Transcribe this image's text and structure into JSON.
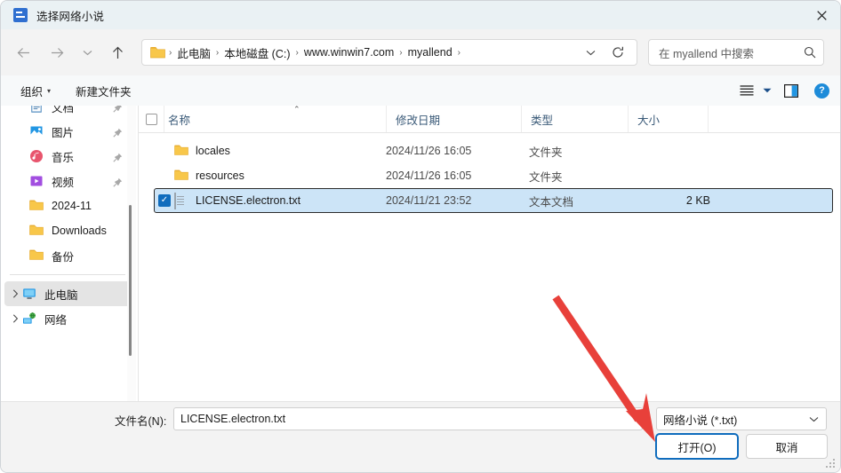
{
  "window": {
    "title": "选择网络小说",
    "app_icon": "app-window-icon",
    "close_label": "×"
  },
  "nav": {
    "back_icon": "arrow-left-icon",
    "forward_icon": "arrow-right-icon",
    "recent_icon": "chevron-down-icon",
    "up_icon": "arrow-up-icon",
    "folder_icon": "folder-icon",
    "breadcrumbs": [
      "此电脑",
      "本地磁盘 (C:)",
      "www.winwin7.com",
      "myallend"
    ],
    "separator": "›",
    "dropdown_icon": "chevron-down-icon",
    "refresh_icon": "refresh-icon"
  },
  "search": {
    "placeholder": "在 myallend 中搜索",
    "icon": "search-icon"
  },
  "toolbar": {
    "organize_label": "组织",
    "organize_caret": "▾",
    "new_folder_label": "新建文件夹",
    "view_icon": "list-view-icon",
    "view_caret": "▾",
    "preview_pane_icon": "preview-pane-icon",
    "help_icon": "help-icon",
    "help_label": "?"
  },
  "sidebar": {
    "items": [
      {
        "label": "文档",
        "icon": "documents-icon",
        "pinned": true,
        "expandable": false,
        "selected": false
      },
      {
        "label": "图片",
        "icon": "pictures-icon",
        "pinned": true,
        "expandable": false,
        "selected": false
      },
      {
        "label": "音乐",
        "icon": "music-icon",
        "pinned": true,
        "expandable": false,
        "selected": false
      },
      {
        "label": "视频",
        "icon": "videos-icon",
        "pinned": true,
        "expandable": false,
        "selected": false
      },
      {
        "label": "2024-11",
        "icon": "folder-icon",
        "pinned": false,
        "expandable": false,
        "selected": false
      },
      {
        "label": "Downloads",
        "icon": "folder-icon",
        "pinned": false,
        "expandable": false,
        "selected": false
      },
      {
        "label": "备份",
        "icon": "folder-icon",
        "pinned": false,
        "expandable": false,
        "selected": false
      }
    ],
    "tree": [
      {
        "label": "此电脑",
        "icon": "this-pc-icon",
        "expandable": true,
        "selected": true
      },
      {
        "label": "网络",
        "icon": "network-icon",
        "expandable": true,
        "selected": false
      }
    ],
    "pin_icon": "pin-icon",
    "chevron": "›"
  },
  "filelist": {
    "columns": [
      {
        "key": "name",
        "label": "名称",
        "sorted": "asc",
        "sort_caret": "⌃"
      },
      {
        "key": "date",
        "label": "修改日期"
      },
      {
        "key": "type",
        "label": "类型"
      },
      {
        "key": "size",
        "label": "大小"
      }
    ],
    "header_checkbox": false,
    "rows": [
      {
        "name": "locales",
        "date": "2024/11/26 16:05",
        "type": "文件夹",
        "size": "",
        "icon": "folder-icon",
        "selected": false,
        "checked": false
      },
      {
        "name": "resources",
        "date": "2024/11/26 16:05",
        "type": "文件夹",
        "size": "",
        "icon": "folder-icon",
        "selected": false,
        "checked": false
      },
      {
        "name": "LICENSE.electron.txt",
        "date": "2024/11/21 23:52",
        "type": "文本文档",
        "size": "2 KB",
        "icon": "text-file-icon",
        "selected": true,
        "checked": true,
        "check_glyph": "✓"
      }
    ]
  },
  "footer": {
    "filename_label": "文件名(N):",
    "filename_value": "LICENSE.electron.txt",
    "filetype_value": "网络小说 (*.txt)",
    "filetype_caret_icon": "chevron-down-icon",
    "open_label": "打开(O)",
    "cancel_label": "取消",
    "resize_grip_icon": "resize-grip-icon"
  },
  "annotation": {
    "arrow_icon": "red-arrow-icon",
    "color": "#e8403a",
    "points_at": "打开(O)"
  },
  "colors": {
    "accent": "#0f6cbd",
    "titlebar_bg": "#eaf1f4",
    "selection_bg": "#cce4f7",
    "annotation_red": "#e8403a",
    "folder_yellow": "#f8c74a",
    "help_blue": "#1d8bd9"
  }
}
